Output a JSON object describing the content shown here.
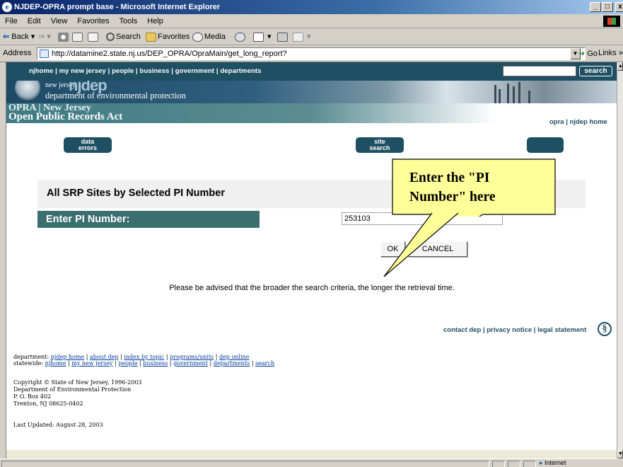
{
  "window": {
    "title": "NJDEP-OPRA prompt base - Microsoft Internet Explorer",
    "minimize": "_",
    "maximize": "□",
    "close": "x"
  },
  "menu": [
    "File",
    "Edit",
    "View",
    "Favorites",
    "Tools",
    "Help"
  ],
  "toolbar": {
    "back": "Back",
    "search": "Search",
    "favorites": "Favorites",
    "media": "Media"
  },
  "address": {
    "label": "Address",
    "url": "http://datamine2.state.nj.us/DEP_OPRA/OpraMain/get_long_report?",
    "go": "Go",
    "links": "Links"
  },
  "site": {
    "nav_links": "njhome | my new jersey | people | business | government | departments",
    "search_button": "search",
    "nj_small": "new jersey",
    "njdep": "njdep",
    "department": "department of environmental protection",
    "opra_line1": "OPRA | New Jersey",
    "opra_line2": "Open Public Records Act",
    "opra_links": "opra | njdep home",
    "btn_data_errors_1": "data",
    "btn_data_errors_2": "errors",
    "btn_site_search_1": "site",
    "btn_site_search_2": "search"
  },
  "form": {
    "heading": "All SRP Sites by Selected PI Number",
    "pi_label": "Enter PI Number:",
    "pi_value": "253103",
    "ok": "OK",
    "cancel": "CANCEL",
    "advice": "Please be advised that the broader the search criteria, the longer the retrieval time."
  },
  "callout": {
    "line1": "Enter the \"PI",
    "line2": "Number\" here"
  },
  "footer": {
    "contact_links": "contact dep | privacy notice | legal statement",
    "department_prefix": "department: ",
    "department_links": [
      "njdep home",
      "about dep",
      "index by topic",
      "programs/units",
      "dep online"
    ],
    "statewide_prefix": "statewide: ",
    "statewide_links": [
      "njhome",
      "my new jersey",
      "people",
      "business",
      "government",
      "departments",
      "search"
    ],
    "copyright": "Copyright © State of New Jersey, 1996-2003",
    "dept_name": "Department of Environmental Protection",
    "po_box": "P. O. Box 402",
    "city": "Trenton, NJ 08625-0402",
    "last_updated": "Last Updated: August 28, 2003"
  },
  "status": {
    "zone": "Internet"
  }
}
